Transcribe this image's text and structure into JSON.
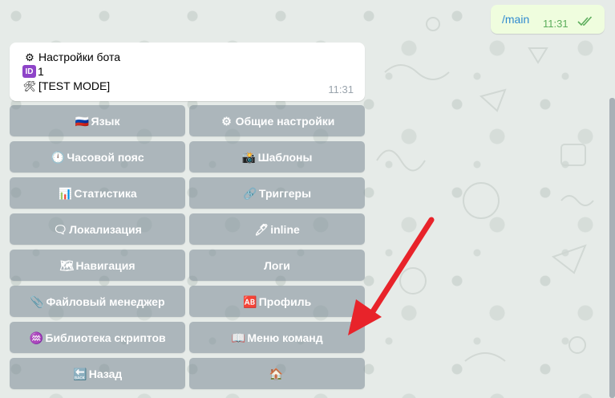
{
  "outgoing_message": {
    "text": "/main",
    "time": "11:31",
    "status_icon": "double-check-icon"
  },
  "incoming_message": {
    "lines": [
      {
        "icon": "gear-icon",
        "icon_glyph": "⚙",
        "text": "Настройки бота"
      },
      {
        "icon": "id-badge-icon",
        "icon_glyph": "ID",
        "text": "1"
      },
      {
        "icon": "tools-icon",
        "icon_glyph": "🛠",
        "text": "[TEST MODE]"
      }
    ],
    "time": "11:31"
  },
  "keyboard": {
    "buttons": [
      {
        "icon": "russia-flag-icon",
        "glyph": "🇷🇺",
        "label": "Язык"
      },
      {
        "icon": "gear-icon",
        "glyph": "⚙",
        "label": "Общие настройки"
      },
      {
        "icon": "clock-icon",
        "glyph": "🕛",
        "label": "Часовой пояс"
      },
      {
        "icon": "camera-icon",
        "glyph": "📸",
        "label": "Шаблоны"
      },
      {
        "icon": "chart-icon",
        "glyph": "📊",
        "label": "Статистика"
      },
      {
        "icon": "link-icon",
        "glyph": "🔗",
        "label": "Триггеры"
      },
      {
        "icon": "speech-bubble-icon",
        "glyph": "🗨",
        "label": "Локализация"
      },
      {
        "icon": "pen-icon",
        "glyph": "🖊",
        "label": "inline"
      },
      {
        "icon": "map-icon",
        "glyph": "🗺",
        "label": "Навигация"
      },
      {
        "icon": "",
        "glyph": "",
        "label": "Логи"
      },
      {
        "icon": "paperclip-icon",
        "glyph": "📎",
        "label": "Файловый менеджер"
      },
      {
        "icon": "ab-button-icon",
        "glyph": "🆎",
        "label": "Профиль"
      },
      {
        "icon": "aquarius-icon",
        "glyph": "♒",
        "label": "Библиотека скриптов"
      },
      {
        "icon": "book-icon",
        "glyph": "📖",
        "label": "Меню команд"
      },
      {
        "icon": "back-arrow-icon",
        "glyph": "🔙",
        "label": "Назад"
      },
      {
        "icon": "house-icon",
        "glyph": "🏠",
        "label": ""
      }
    ]
  },
  "colors": {
    "accent_arrow": "#e8232a",
    "button_bg": "#8a98a2",
    "outgoing_bg": "#effdde"
  }
}
